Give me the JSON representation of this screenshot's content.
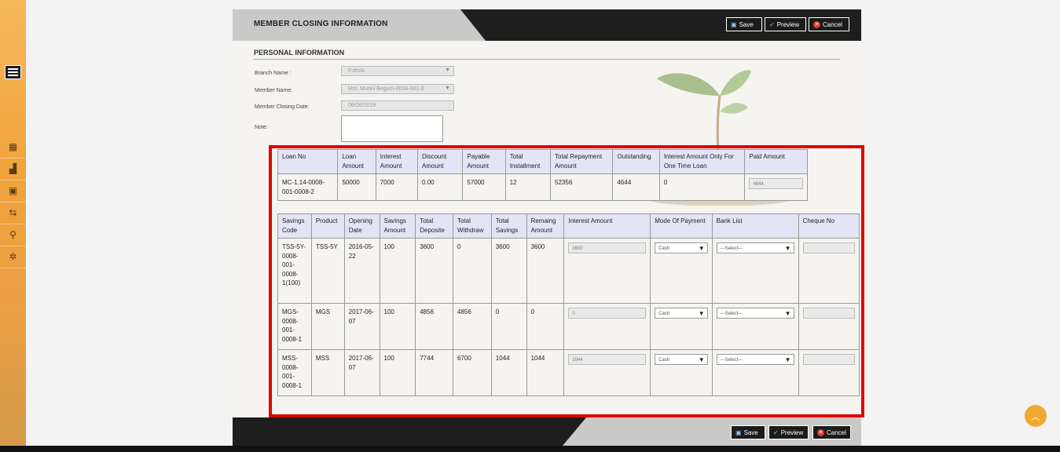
{
  "page_title": "MEMBER CLOSING INFORMATION",
  "toolbar": {
    "save": "Save",
    "preview": "Preview",
    "cancel": "Cancel"
  },
  "section_title": "PERSONAL INFORMATION",
  "form": {
    "branch_label": "Branch Name :",
    "branch_value": "Fultola",
    "member_label": "Member Name:",
    "member_value": "Mst. Munni Begum-0008-001-0",
    "closing_date_label": "Member Closing Date:",
    "closing_date_value": "06/26/2019",
    "note_label": "Note:"
  },
  "loan_table": {
    "headers": [
      "Loan No",
      "Loan Amount",
      "Interest Amount",
      "Discount Amount",
      "Payable Amount",
      "Total Installment",
      "Total Repayment Amount",
      "Outstanding",
      "Interest Amount Only For One Time Loan",
      "Paid Amount"
    ],
    "row": [
      "MC-1.14-0008-001-0008-2",
      "50000",
      "7000",
      "0.00",
      "57000",
      "12",
      "52356",
      "4644",
      "0",
      "4644"
    ]
  },
  "savings_table": {
    "headers": [
      "Savings Code",
      "Product",
      "Opening Date",
      "Savings Amount",
      "Total Deposite",
      "Total Withdraw",
      "Total Savings",
      "Remaing Amount",
      "Interest Amount",
      "Mode Of Payment",
      "Bank List",
      "Cheque No"
    ],
    "rows": [
      {
        "code": "TSS-5Y-0008-001-0008-1(100)",
        "product": "TSS-5Y",
        "opening": "2016-05-22",
        "amount": "100",
        "deposit": "3600",
        "withdraw": "0",
        "total": "3600",
        "remaining": "3600",
        "interest": "3600",
        "mode": "Cash",
        "bank": "---Select---",
        "cheque": ""
      },
      {
        "code": "MGS-0008-001-0008-1",
        "product": "MGS",
        "opening": "2017-06-07",
        "amount": "100",
        "deposit": "4856",
        "withdraw": "4856",
        "total": "0",
        "remaining": "0",
        "interest": "0",
        "mode": "Cash",
        "bank": "---Select---",
        "cheque": ""
      },
      {
        "code": "MSS-0008-001-0008-1",
        "product": "MSS",
        "opening": "2017-06-07",
        "amount": "100",
        "deposit": "7744",
        "withdraw": "6700",
        "total": "1044",
        "remaining": "1044",
        "interest": "1044",
        "mode": "Cash",
        "bank": "---Select---",
        "cheque": ""
      }
    ]
  },
  "colors": {
    "accent": "#f0a33c",
    "header_dark": "#1e1e1e",
    "highlight": "#e00000",
    "table_header": "#e3e5f6"
  },
  "icons": [
    "menu-icon",
    "building-icon",
    "chart-icon",
    "briefcase-icon",
    "transfer-icon",
    "search-icon",
    "settings-icon",
    "save-icon",
    "check-icon",
    "cancel-icon",
    "chevron-up-icon"
  ]
}
